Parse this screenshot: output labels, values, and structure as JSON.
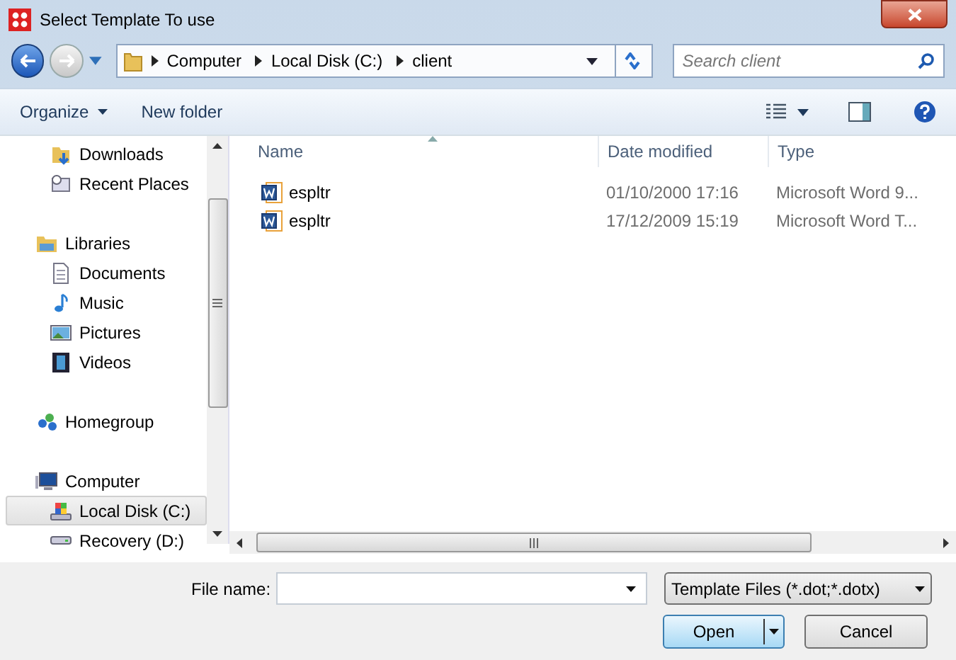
{
  "window": {
    "title": "Select Template To use"
  },
  "address": {
    "crumbs": [
      "Computer",
      "Local Disk (C:)",
      "client"
    ]
  },
  "search": {
    "placeholder": "Search client"
  },
  "toolbar": {
    "buttons": [
      "Organize",
      "New folder"
    ]
  },
  "nav_groups": [
    {
      "children": [
        {
          "label": "Downloads",
          "selected": false
        },
        {
          "label": "Recent Places",
          "selected": false
        }
      ]
    },
    {
      "label": "Libraries",
      "selected": false,
      "children": [
        {
          "label": "Documents",
          "selected": false
        },
        {
          "label": "Music",
          "selected": false
        },
        {
          "label": "Pictures",
          "selected": false
        },
        {
          "label": "Videos",
          "selected": false
        }
      ]
    },
    {
      "label": "Homegroup",
      "selected": false
    },
    {
      "label": "Computer",
      "selected": false,
      "children": [
        {
          "label": "Local Disk (C:)",
          "selected": true
        },
        {
          "label": "Recovery (D:)",
          "selected": false
        }
      ]
    }
  ],
  "table": {
    "columns": [
      "Name",
      "Date modified",
      "Type"
    ],
    "rows": [
      {
        "name": "espltr",
        "date": "01/10/2000 17:16",
        "type": "Microsoft Word 9..."
      },
      {
        "name": "espltr",
        "date": "17/12/2009 15:19",
        "type": "Microsoft Word T..."
      }
    ]
  },
  "file_name": {
    "label": "File name:"
  },
  "file_type": {
    "value": "Template Files (*.dot;*.dotx)"
  },
  "buttons": [
    "Open",
    "Cancel"
  ]
}
